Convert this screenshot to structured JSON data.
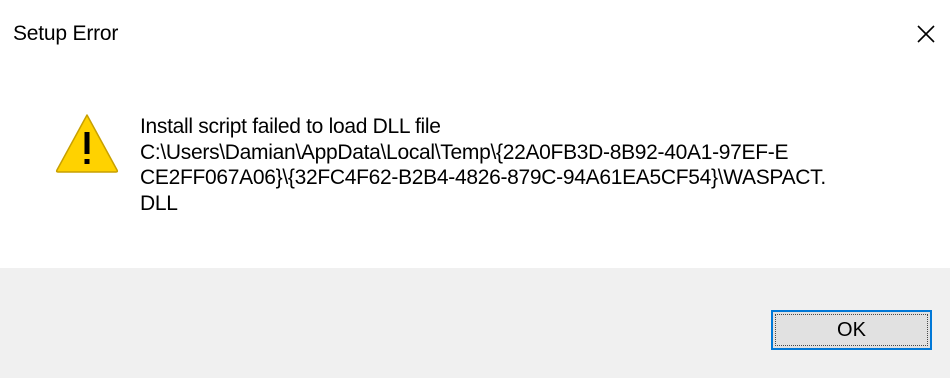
{
  "window": {
    "title": "Setup Error",
    "close_icon": "close-icon"
  },
  "message": {
    "icon": "warning-icon",
    "lines": [
      "Install script failed to load DLL file",
      "C:\\Users\\Damian\\AppData\\Local\\Temp\\{22A0FB3D-8B92-40A1-97EF-E",
      "CE2FF067A06}\\{32FC4F62-B2B4-4826-879C-94A61EA5CF54}\\WASPACT.",
      "DLL"
    ]
  },
  "buttons": {
    "ok_label": "OK"
  },
  "colors": {
    "footer_background": "#f0f0f0",
    "button_focus_border": "#0078d7",
    "warning_fill": "#ffd200"
  }
}
